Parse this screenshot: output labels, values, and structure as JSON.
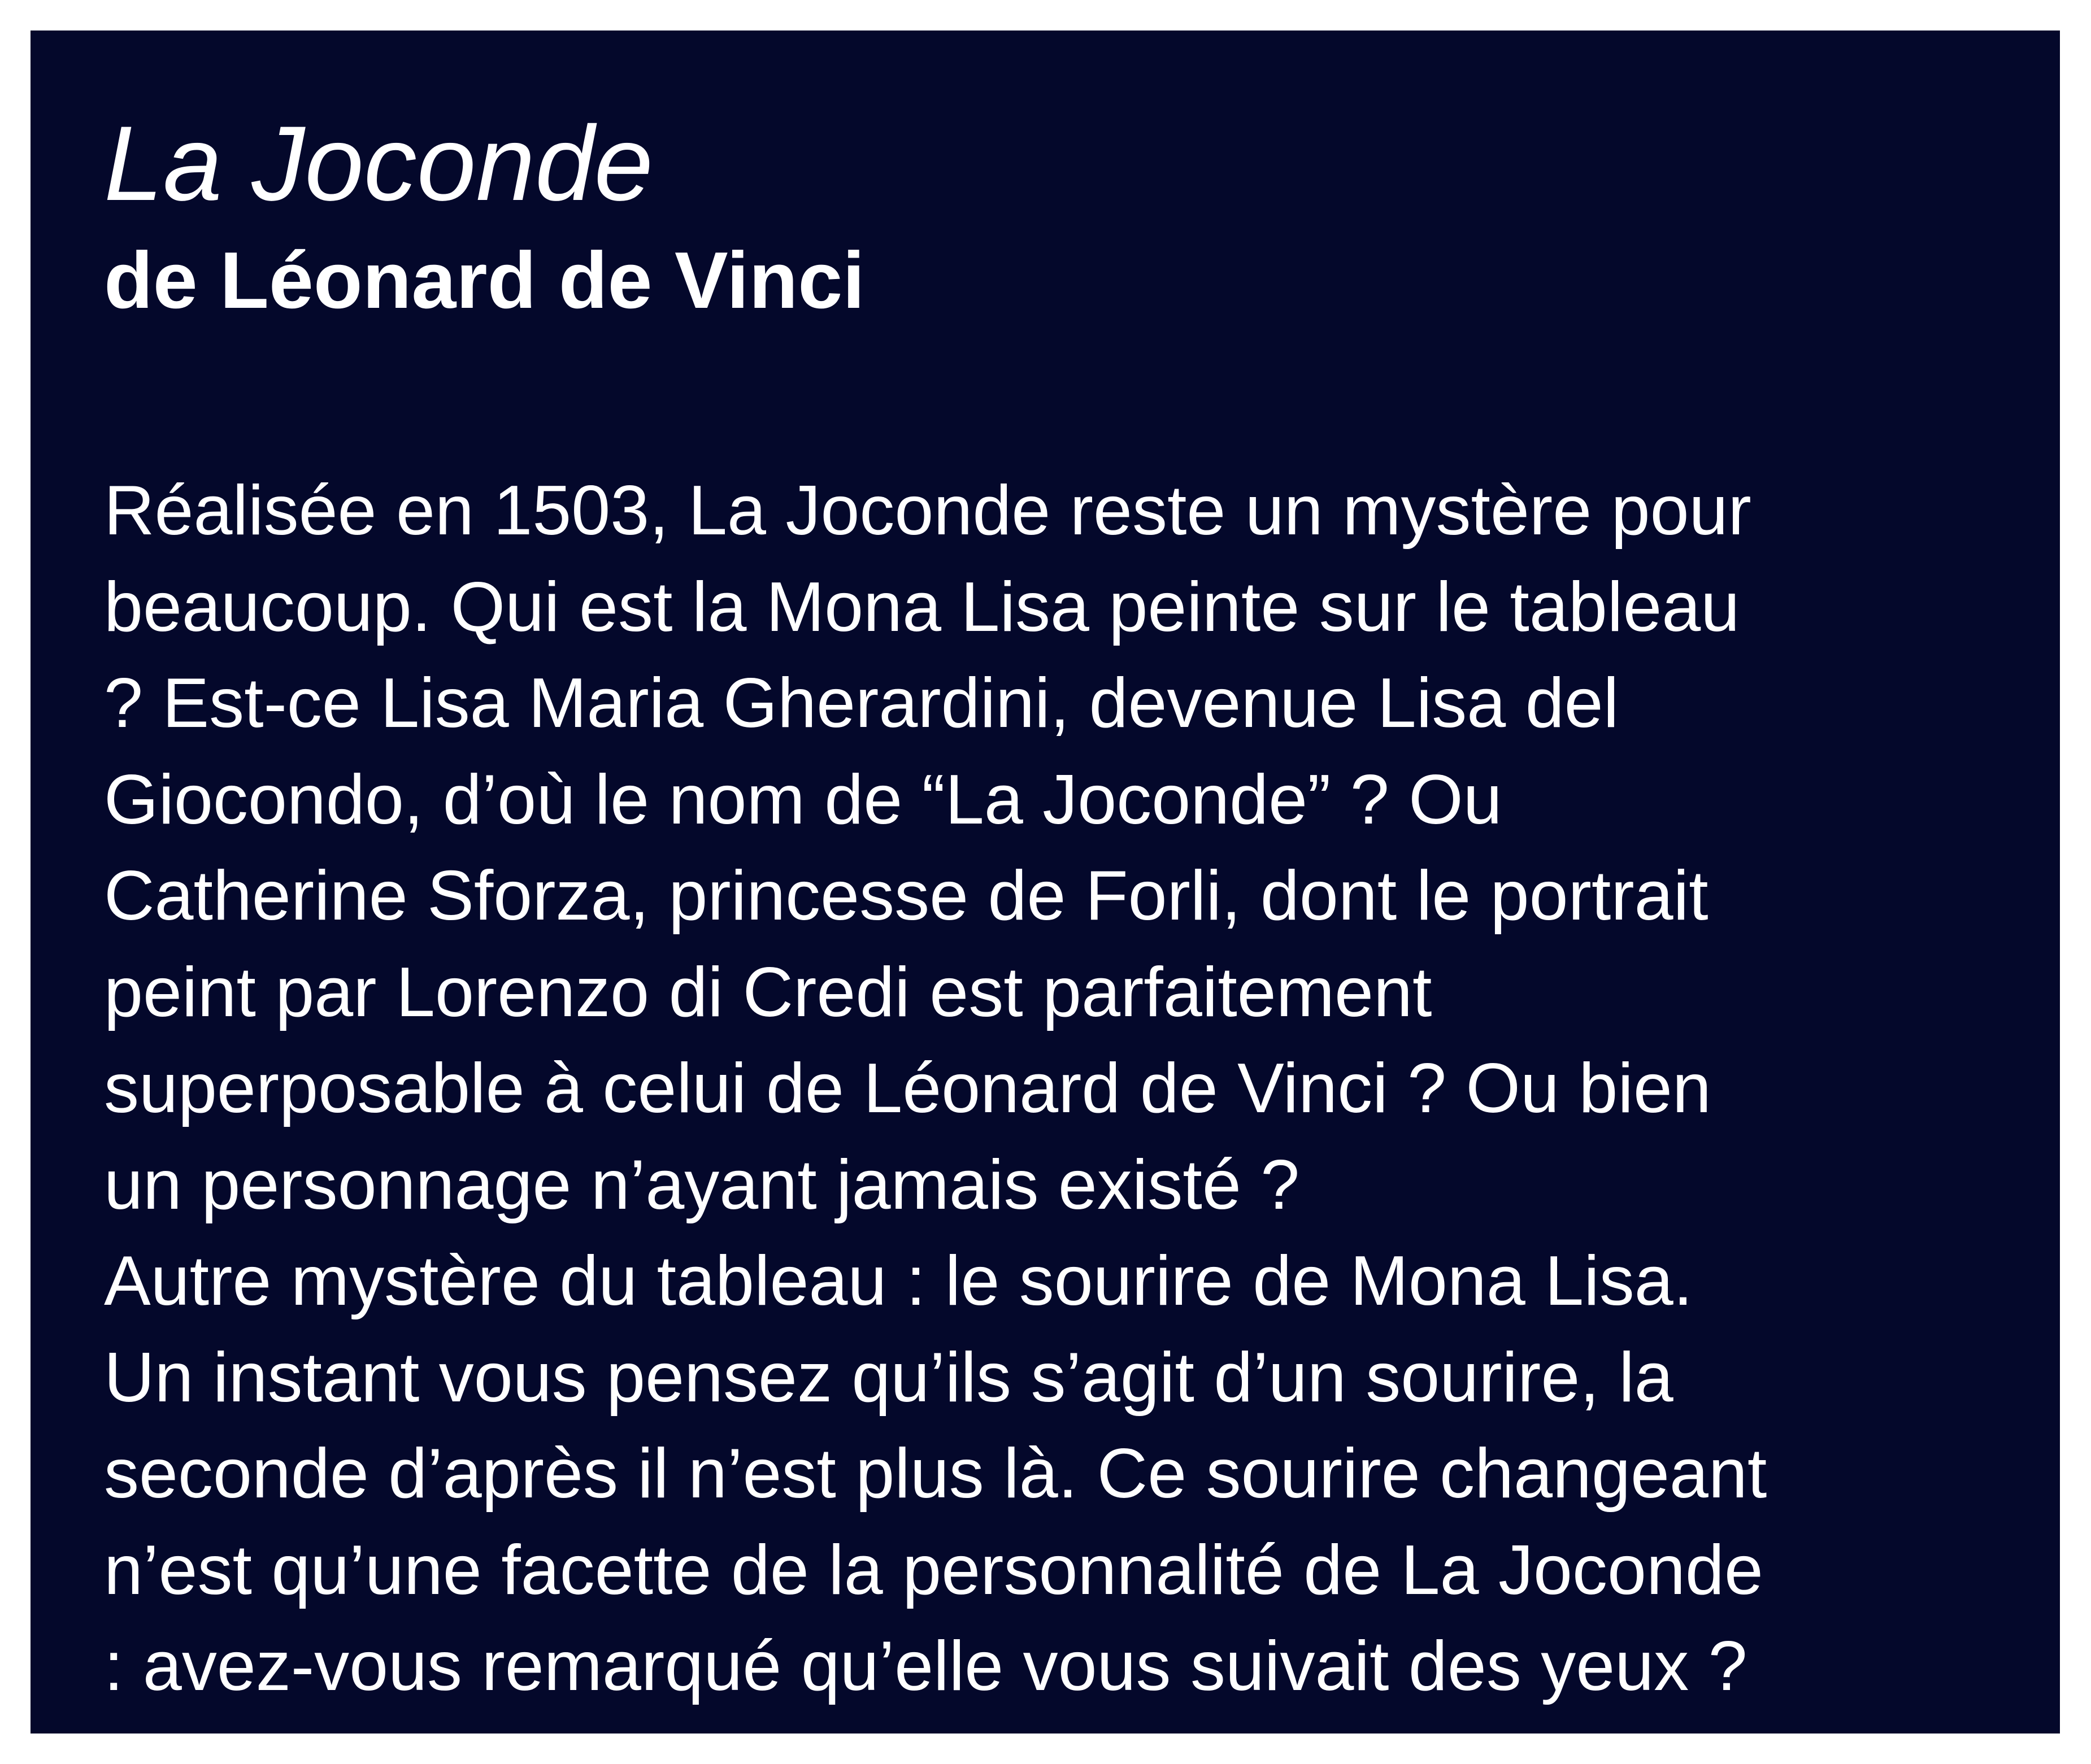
{
  "colors": {
    "page_background": "#ffffff",
    "panel_background": "#04082b",
    "text": "#ffffff"
  },
  "title": "La Joconde",
  "subtitle": "de Léonard de Vinci",
  "body_lines": [
    "Réalisée en 1503, La Joconde reste un mystère pour",
    "beaucoup. Qui est la Mona Lisa peinte sur le tableau",
    "?  Est-ce Lisa Maria Gherardini, devenue Lisa del",
    "Giocondo, d’où le nom de “La Joconde” ? Ou",
    "Catherine Sforza, princesse de Forli, dont le portrait",
    "peint par Lorenzo di Credi est parfaitement",
    "superposable à celui de Léonard de Vinci ? Ou bien",
    "un personnage n’ayant jamais existé ?",
    "Autre mystère du tableau : le sourire de Mona Lisa.",
    "Un instant vous pensez qu’ils s’agit d’un sourire, la",
    "seconde d’après il n’est plus là. Ce sourire changeant",
    "n’est qu’une facette de la personnalité de La Joconde",
    ": avez-vous remarqué qu’elle vous suivait des yeux ?"
  ]
}
